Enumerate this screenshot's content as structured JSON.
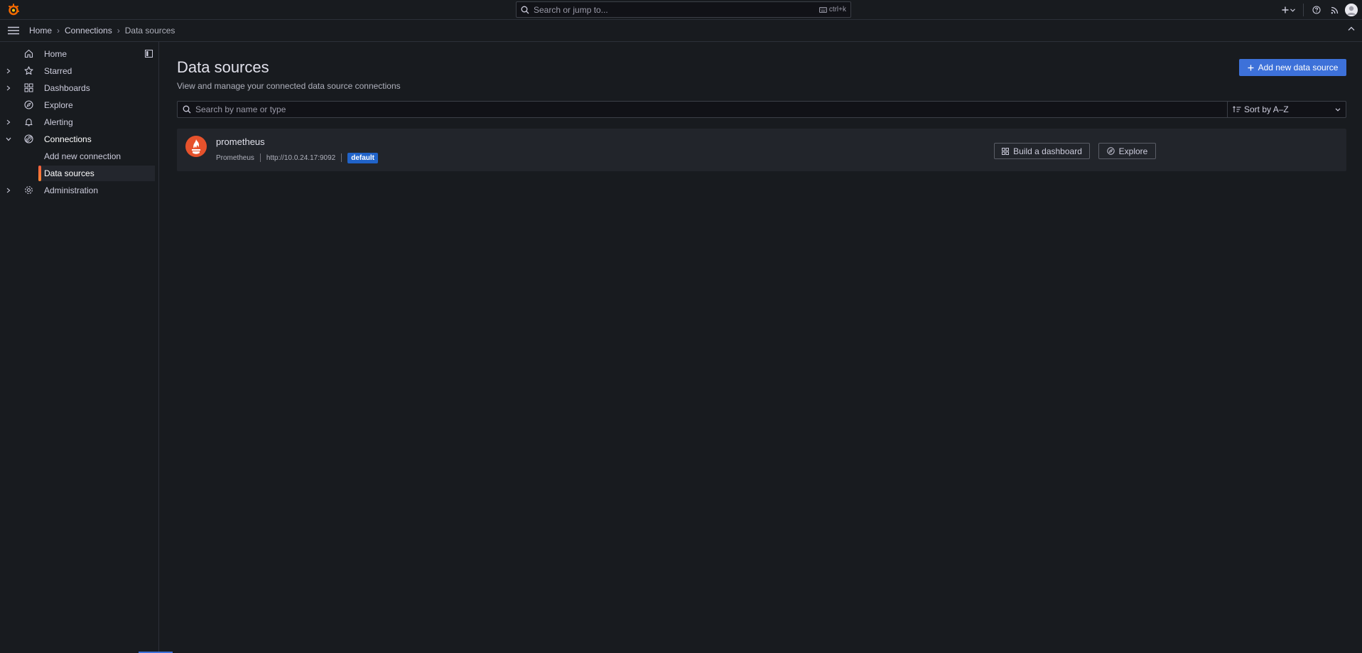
{
  "topbar": {
    "search_placeholder": "Search or jump to...",
    "shortcut": "ctrl+k",
    "icons": [
      "grafana-logo-icon",
      "search-icon",
      "keyboard-icon",
      "plus-icon",
      "chevron-down-icon",
      "help-icon",
      "news-rss-icon",
      "user-avatar"
    ]
  },
  "breadcrumb": {
    "items": [
      "Home",
      "Connections",
      "Data sources"
    ]
  },
  "sidebar": {
    "items": [
      {
        "label": "Home",
        "icon": "home-icon",
        "expandable": false
      },
      {
        "label": "Starred",
        "icon": "star-icon",
        "expandable": true
      },
      {
        "label": "Dashboards",
        "icon": "apps-grid-icon",
        "expandable": true
      },
      {
        "label": "Explore",
        "icon": "compass-icon",
        "expandable": false
      },
      {
        "label": "Alerting",
        "icon": "bell-icon",
        "expandable": true
      },
      {
        "label": "Connections",
        "icon": "link-icon",
        "expandable": true,
        "expanded": true
      },
      {
        "label": "Administration",
        "icon": "cog-icon",
        "expandable": true
      }
    ],
    "subitems": [
      {
        "label": "Add new connection"
      },
      {
        "label": "Data sources",
        "selected": true
      }
    ]
  },
  "page": {
    "title": "Data sources",
    "subtitle": "View and manage your connected data source connections",
    "add_button": "Add new data source",
    "search_placeholder": "Search by name or type",
    "sort_value": "Sort by A–Z"
  },
  "datasources": [
    {
      "name": "prometheus",
      "type": "Prometheus",
      "url": "http://10.0.24.17:9092",
      "badge": "default",
      "actions": [
        "Build a dashboard",
        "Explore"
      ]
    }
  ],
  "colors": {
    "background": "#181b1f",
    "primary": "#3d71d9",
    "brand": "#f05a28",
    "active_indicator": "#f55f3e",
    "badge": "#2063c9"
  }
}
